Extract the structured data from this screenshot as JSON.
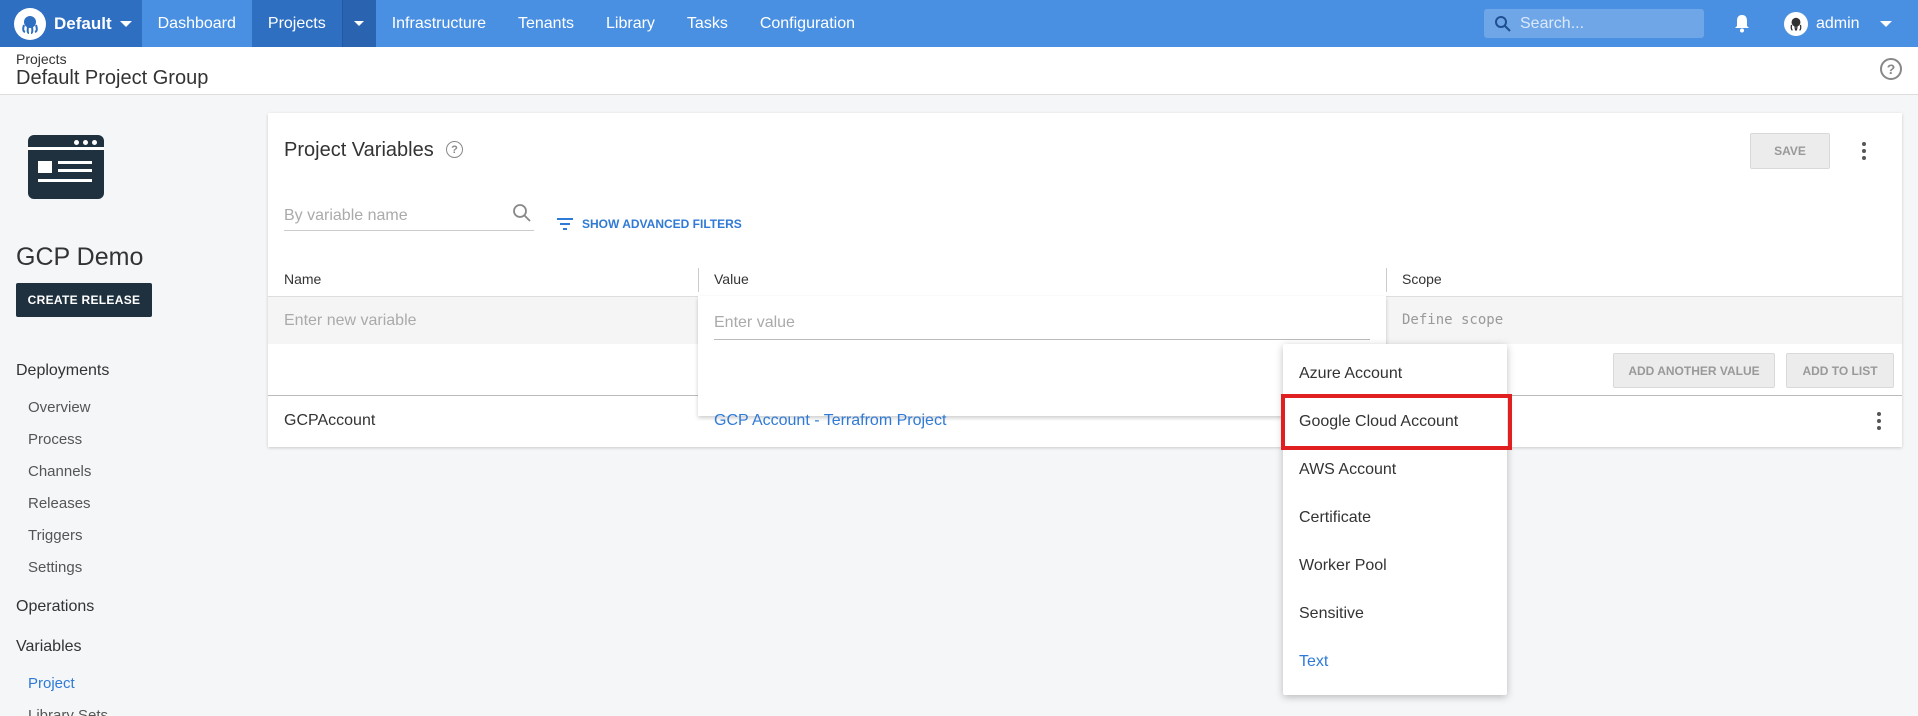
{
  "topnav": {
    "space": "Default",
    "items": [
      "Dashboard",
      "Projects",
      "Infrastructure",
      "Tenants",
      "Library",
      "Tasks",
      "Configuration"
    ],
    "search_placeholder": "Search...",
    "user": "admin",
    "brand_color": "#4a90e2"
  },
  "header": {
    "breadcrumb": "Projects",
    "title": "Default Project Group",
    "help_icon": "?"
  },
  "sidebar": {
    "project_name": "GCP Demo",
    "create_release": "CREATE RELEASE",
    "deployments": "Deployments",
    "deploy_items": [
      "Overview",
      "Process",
      "Channels",
      "Releases",
      "Triggers",
      "Settings"
    ],
    "operations": "Operations",
    "variables": "Variables",
    "variable_items": [
      "Project",
      "Library Sets"
    ]
  },
  "main": {
    "title": "Project Variables",
    "save": "SAVE",
    "filter_placeholder": "By variable name",
    "advanced_filters": "SHOW ADVANCED FILTERS",
    "columns": [
      "Name",
      "Value",
      "Scope"
    ],
    "new_name_placeholder": "Enter new variable",
    "value_placeholder": "Enter value",
    "scope_placeholder": "Define scope",
    "add_another": "ADD ANOTHER VALUE",
    "add_to_list": "ADD TO LIST",
    "variable": {
      "name": "GCPAccount",
      "value": "GCP Account - Terrafrom Project"
    }
  },
  "type_menu": {
    "items": [
      "Azure Account",
      "Google Cloud Account",
      "AWS Account",
      "Certificate",
      "Worker Pool",
      "Sensitive",
      "Text"
    ],
    "selected": "Text",
    "highlighted": "Google Cloud Account",
    "highlight_color": "#e02020"
  }
}
